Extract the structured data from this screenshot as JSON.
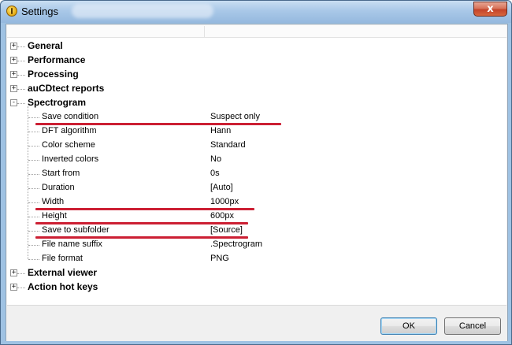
{
  "window": {
    "title": "Settings",
    "close_glyph": "x",
    "app_icon": "foobar-app-icon"
  },
  "tree": {
    "expand_glyph": "+",
    "collapse_glyph": "-",
    "categories_before": [
      {
        "label": "General",
        "expanded": false
      },
      {
        "label": "Performance",
        "expanded": false
      },
      {
        "label": "Processing",
        "expanded": false
      },
      {
        "label": "auCDtect reports",
        "expanded": false
      }
    ],
    "open_category": {
      "label": "Spectrogram",
      "expanded": true,
      "properties": [
        {
          "name": "Save condition",
          "value": "Suspect only",
          "highlighted": true
        },
        {
          "name": "DFT algorithm",
          "value": "Hann",
          "highlighted": false
        },
        {
          "name": "Color scheme",
          "value": "Standard",
          "highlighted": false
        },
        {
          "name": "Inverted colors",
          "value": "No",
          "highlighted": false
        },
        {
          "name": "Start from",
          "value": "0s",
          "highlighted": false
        },
        {
          "name": "Duration",
          "value": "[Auto]",
          "highlighted": false
        },
        {
          "name": "Width",
          "value": "1000px",
          "highlighted": true
        },
        {
          "name": "Height",
          "value": "600px",
          "highlighted": true
        },
        {
          "name": "Save to subfolder",
          "value": "[Source]",
          "highlighted": true
        },
        {
          "name": "File name suffix",
          "value": ".Spectrogram",
          "highlighted": false
        },
        {
          "name": "File format",
          "value": "PNG",
          "highlighted": false
        }
      ]
    },
    "categories_after": [
      {
        "label": "External viewer",
        "expanded": false
      },
      {
        "label": "Action hot keys",
        "expanded": false
      }
    ]
  },
  "buttons": {
    "ok": "OK",
    "cancel": "Cancel"
  },
  "colors": {
    "highlight_underline": "#cc1f33",
    "title_bar": "#a9c8e8",
    "close_button": "#c4442a"
  }
}
